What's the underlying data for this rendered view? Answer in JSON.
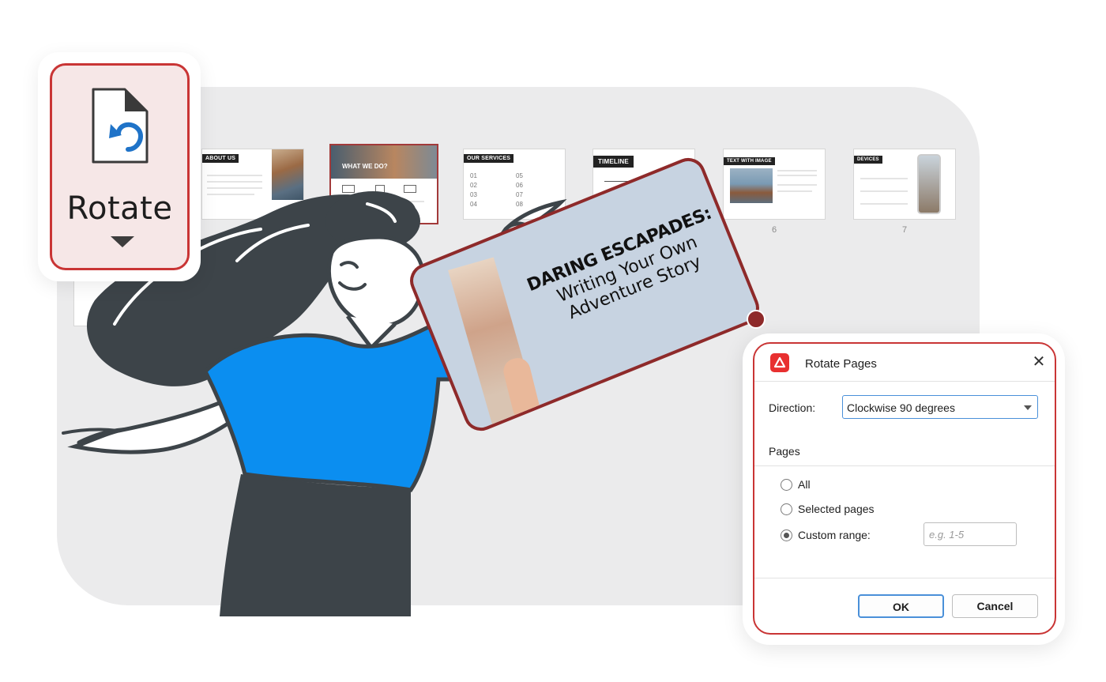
{
  "rotate_button": {
    "label": "Rotate",
    "icon": "page-rotate-icon"
  },
  "thumbnails": [
    {
      "header": "ABOUT US",
      "number": ""
    },
    {
      "header": "WHAT WE DO?",
      "number": ""
    },
    {
      "header": "OUR SERVICES",
      "number": "",
      "items": [
        "01",
        "02",
        "03",
        "04",
        "05",
        "06",
        "07",
        "08"
      ]
    },
    {
      "header": "TIMELINE",
      "number": ""
    },
    {
      "header": "TEXT WITH IMAGE",
      "number": "6"
    },
    {
      "header": "DEVICES",
      "number": "7"
    }
  ],
  "card": {
    "title": "DARING ESCAPADES:",
    "subtitle_line1": "Writing Your Own",
    "subtitle_line2": "Adventure Story"
  },
  "dialog": {
    "title": "Rotate Pages",
    "close_glyph": "✕",
    "direction_label": "Direction:",
    "direction_value": "Clockwise 90 degrees",
    "pages_label": "Pages",
    "options": [
      "All",
      "Selected pages",
      "Custom range:"
    ],
    "selected_option": "Custom range:",
    "range_placeholder": "e.g. 1-5",
    "ok_label": "OK",
    "cancel_label": "Cancel"
  },
  "colors": {
    "accent": "#c93535",
    "shirt": "#0b8ef0",
    "hair": "#3d4449",
    "focus": "#4a90d9"
  }
}
